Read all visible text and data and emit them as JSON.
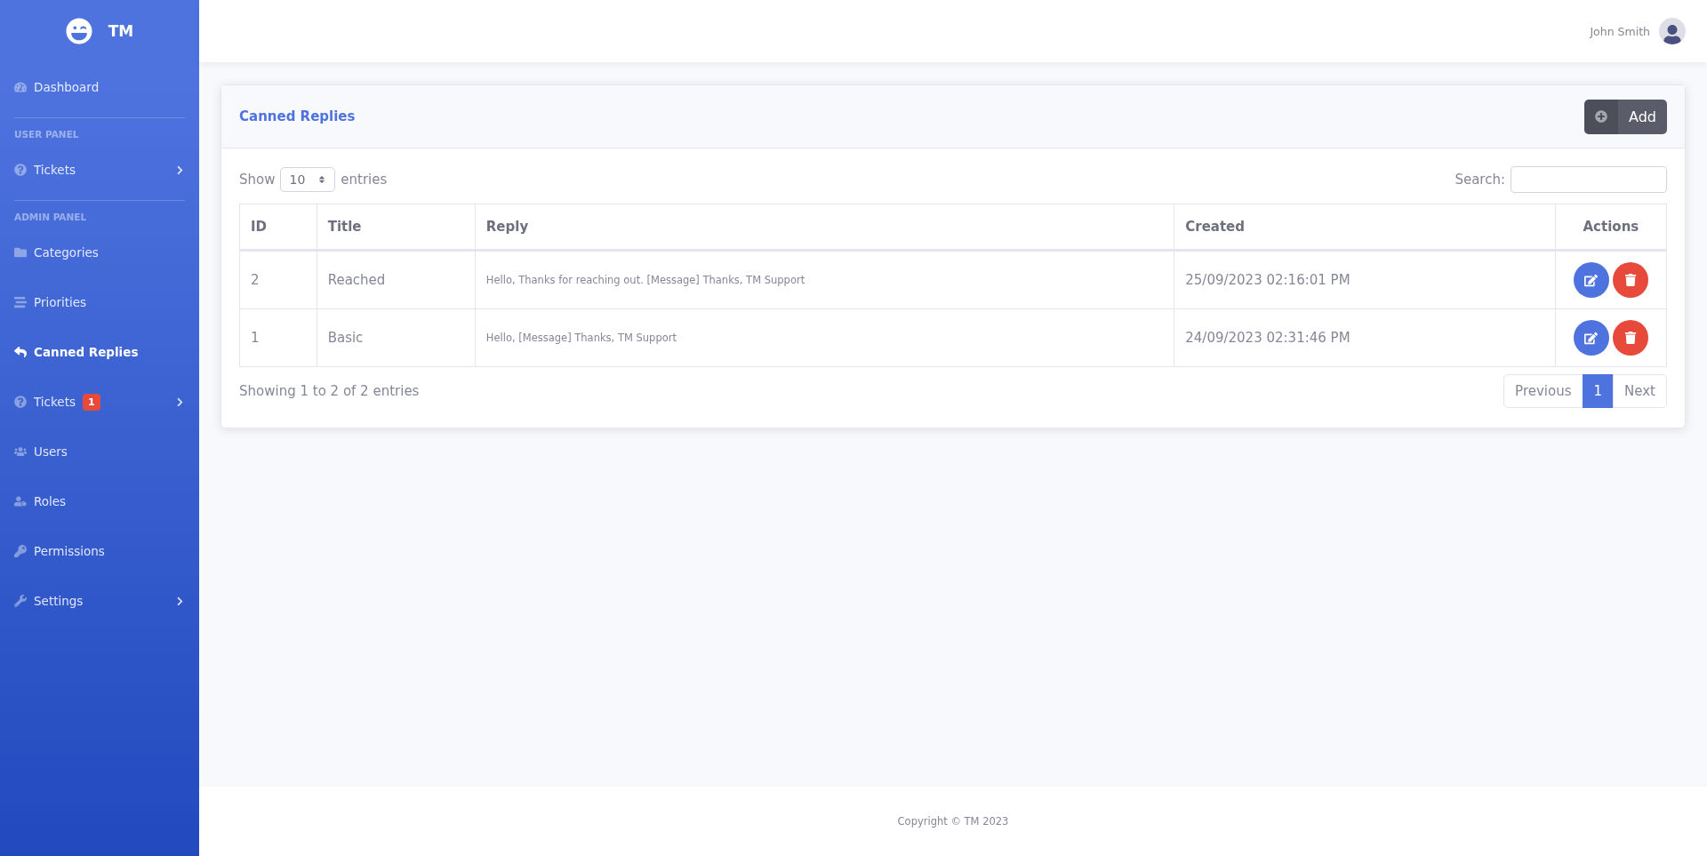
{
  "brand": {
    "name": "TM"
  },
  "sidebar": {
    "sections": [
      {
        "items": [
          {
            "label": "Dashboard",
            "selected": false,
            "expandable": false
          }
        ]
      },
      {
        "heading": "USER PANEL",
        "items": [
          {
            "label": "Tickets",
            "selected": false,
            "expandable": true
          }
        ]
      },
      {
        "heading": "ADMIN PANEL",
        "items": [
          {
            "label": "Categories",
            "selected": false,
            "expandable": false
          },
          {
            "label": "Priorities",
            "selected": false,
            "expandable": false
          },
          {
            "label": "Canned Replies",
            "selected": true,
            "expandable": false
          },
          {
            "label": "Tickets",
            "selected": false,
            "expandable": true,
            "badge": "1"
          },
          {
            "label": "Users",
            "selected": false,
            "expandable": false
          },
          {
            "label": "Roles",
            "selected": false,
            "expandable": false
          },
          {
            "label": "Permissions",
            "selected": false,
            "expandable": false
          },
          {
            "label": "Settings",
            "selected": false,
            "expandable": true
          }
        ]
      }
    ]
  },
  "topbar": {
    "user_name": "John Smith"
  },
  "card": {
    "title": "Canned Replies",
    "add_button": "Add",
    "length": {
      "before": "Show",
      "value": "10",
      "after": "entries"
    },
    "search": {
      "label": "Search:"
    },
    "table": {
      "columns": [
        "ID",
        "Title",
        "Reply",
        "Created",
        "Actions"
      ],
      "rows": [
        {
          "id": "2",
          "title": "Reached",
          "reply": "Hello, Thanks for reaching out. [Message] Thanks, TM Support",
          "created": "25/09/2023 02:16:01 PM"
        },
        {
          "id": "1",
          "title": "Basic",
          "reply": "Hello, [Message] Thanks, TM Support",
          "created": "24/09/2023 02:31:46 PM"
        }
      ]
    },
    "info": "Showing 1 to 2 of 2 entries",
    "pagination": [
      {
        "label": "Previous",
        "selected": false
      },
      {
        "label": "1",
        "selected": true
      },
      {
        "label": "Next",
        "selected": false
      }
    ]
  },
  "footer": {
    "text": "Copyright © TM 2023"
  }
}
